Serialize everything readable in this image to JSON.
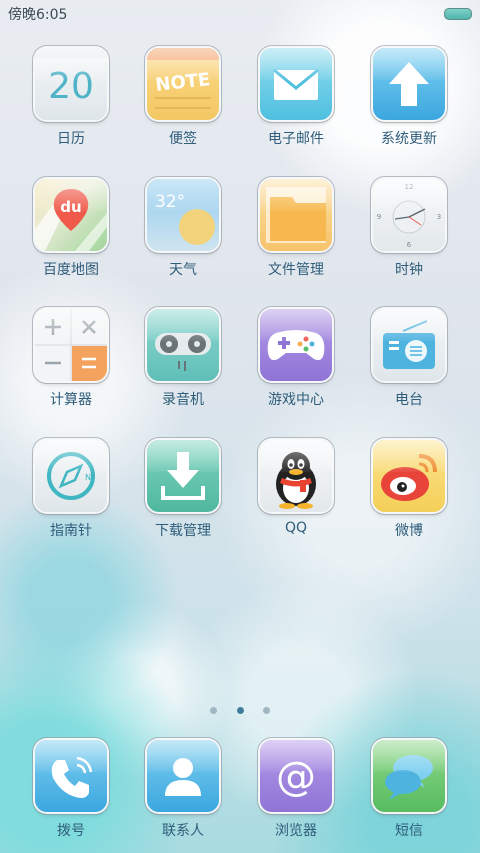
{
  "status": {
    "time": "傍晚6:05"
  },
  "apps": {
    "calendar": {
      "label": "日历",
      "day": "20"
    },
    "notes": {
      "label": "便签",
      "icon_text": "NOTE"
    },
    "email": {
      "label": "电子邮件"
    },
    "update": {
      "label": "系统更新"
    },
    "baidu_map": {
      "label": "百度地图",
      "icon_text": "du"
    },
    "weather": {
      "label": "天气",
      "temperature": "32°"
    },
    "file_manager": {
      "label": "文件管理"
    },
    "clock": {
      "label": "时钟",
      "n12": "12",
      "n3": "3",
      "n6": "6",
      "n9": "9"
    },
    "calculator": {
      "label": "计算器"
    },
    "recorder": {
      "label": "录音机"
    },
    "game_center": {
      "label": "游戏中心"
    },
    "radio": {
      "label": "电台"
    },
    "compass": {
      "label": "指南针",
      "icon_text": "N"
    },
    "download_manager": {
      "label": "下载管理"
    },
    "qq": {
      "label": "QQ"
    },
    "weibo": {
      "label": "微博"
    }
  },
  "page_indicator": {
    "count": 3,
    "active_index": 1
  },
  "dock": {
    "phone": {
      "label": "拨号"
    },
    "contacts": {
      "label": "联系人"
    },
    "browser": {
      "label": "浏览器",
      "icon_text": "@"
    },
    "messages": {
      "label": "短信"
    }
  }
}
